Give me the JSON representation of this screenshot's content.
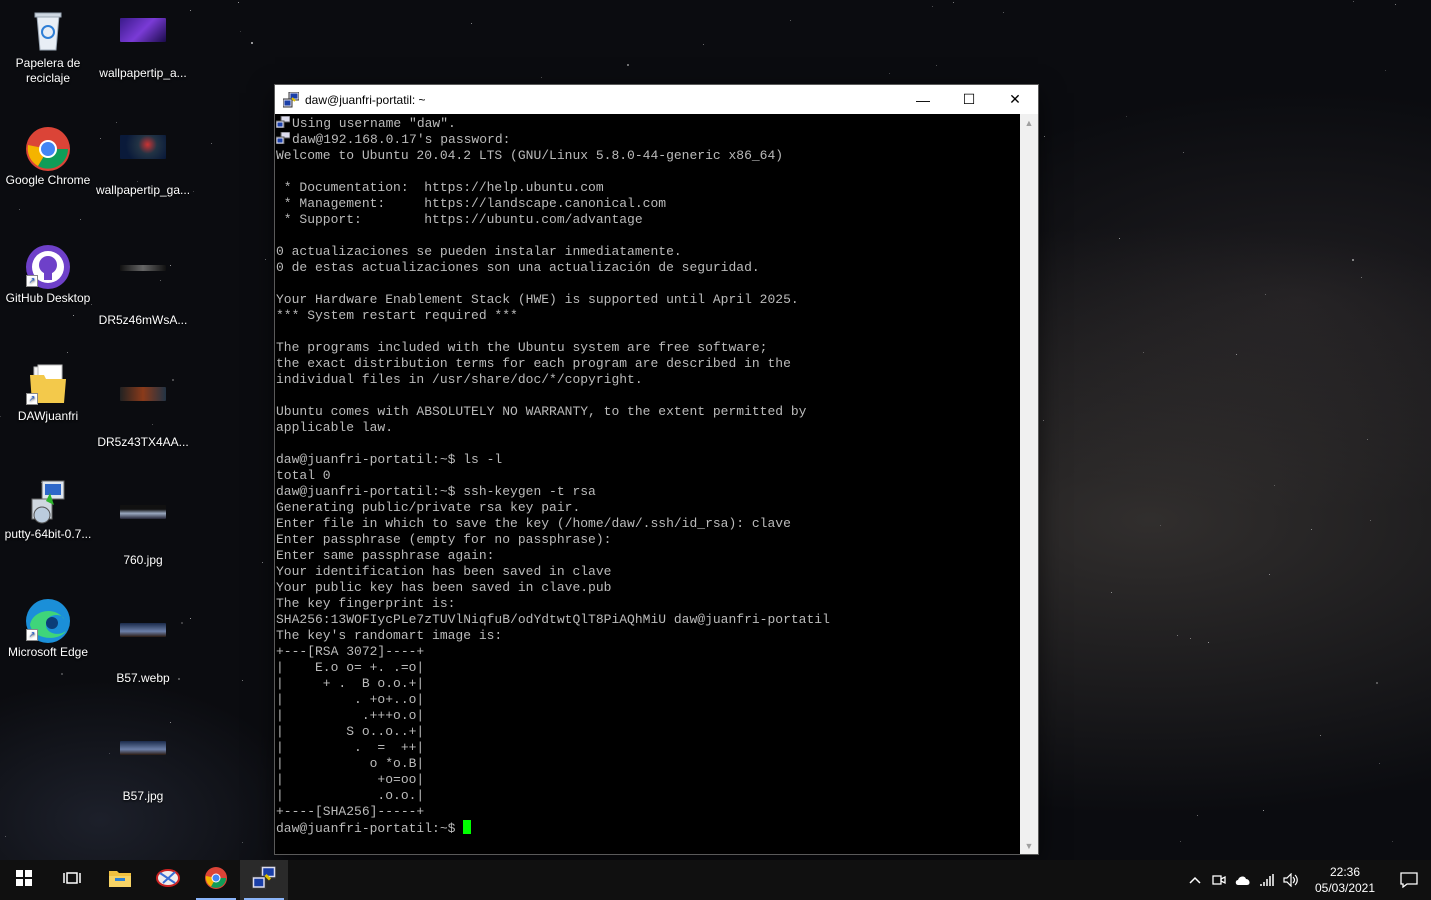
{
  "desktop": {
    "icons": [
      {
        "label": "Papelera de reciclaje",
        "icon": "recycle-bin-icon"
      },
      {
        "label": "wallpapertip_a...",
        "icon": "image-file-icon"
      },
      {
        "label": "Google Chrome",
        "icon": "chrome-icon"
      },
      {
        "label": "wallpapertip_ga...",
        "icon": "image-file-icon"
      },
      {
        "label": "GitHub Desktop",
        "icon": "github-desktop-icon"
      },
      {
        "label": "DR5z46mWsA...",
        "icon": "image-file-icon"
      },
      {
        "label": "DAWjuanfri",
        "icon": "folder-icon"
      },
      {
        "label": "DR5z43TX4AA...",
        "icon": "image-file-icon"
      },
      {
        "label": "putty-64bit-0.7...",
        "icon": "installer-icon"
      },
      {
        "label": "760.jpg",
        "icon": "image-file-icon"
      },
      {
        "label": "Microsoft Edge",
        "icon": "edge-icon"
      },
      {
        "label": "B57.webp",
        "icon": "image-file-icon"
      },
      {
        "label": "B57.jpg",
        "icon": "image-file-icon"
      }
    ]
  },
  "window": {
    "title": "daw@juanfri-portatil: ~",
    "minimize_glyph": "—",
    "maximize_glyph": "☐",
    "close_glyph": "✕"
  },
  "terminal": {
    "lines": [
      "Using username \"daw\".",
      "daw@192.168.0.17's password:",
      "Welcome to Ubuntu 20.04.2 LTS (GNU/Linux 5.8.0-44-generic x86_64)",
      "",
      " * Documentation:  https://help.ubuntu.com",
      " * Management:     https://landscape.canonical.com",
      " * Support:        https://ubuntu.com/advantage",
      "",
      "0 actualizaciones se pueden instalar inmediatamente.",
      "0 de estas actualizaciones son una actualización de seguridad.",
      "",
      "Your Hardware Enablement Stack (HWE) is supported until April 2025.",
      "*** System restart required ***",
      "",
      "The programs included with the Ubuntu system are free software;",
      "the exact distribution terms for each program are described in the",
      "individual files in /usr/share/doc/*/copyright.",
      "",
      "Ubuntu comes with ABSOLUTELY NO WARRANTY, to the extent permitted by",
      "applicable law.",
      "",
      "daw@juanfri-portatil:~$ ls -l",
      "total 0",
      "daw@juanfri-portatil:~$ ssh-keygen -t rsa",
      "Generating public/private rsa key pair.",
      "Enter file in which to save the key (/home/daw/.ssh/id_rsa): clave",
      "Enter passphrase (empty for no passphrase):",
      "Enter same passphrase again:",
      "Your identification has been saved in clave",
      "Your public key has been saved in clave.pub",
      "The key fingerprint is:",
      "SHA256:13WOFIycPLe7zTUVlNiqfuB/odYdtwtQlT8PiAQhMiU daw@juanfri-portatil",
      "The key's randomart image is:",
      "+---[RSA 3072]----+",
      "|    E.o o= +. .=o|",
      "|     + .  B o.o.+|",
      "|         . +o+..o|",
      "|          .+++o.o|",
      "|        S o..o..+|",
      "|         .  =  ++|",
      "|           o *o.B|",
      "|            +o=oo|",
      "|            .o.o.|",
      "+----[SHA256]-----+"
    ],
    "prompt": "daw@juanfri-portatil:~$ "
  },
  "taskbar": {
    "items": [
      {
        "icon": "windows-start-icon"
      },
      {
        "icon": "task-view-icon"
      },
      {
        "icon": "file-explorer-icon"
      },
      {
        "icon": "snipping-tool-icon"
      },
      {
        "icon": "chrome-icon"
      },
      {
        "icon": "putty-icon",
        "active": true
      }
    ],
    "clock_time": "22:36",
    "clock_date": "05/03/2021"
  },
  "colors": {
    "terminal_text": "#bbbbbb",
    "cursor": "#00ff00",
    "taskbar_bg": "#101010"
  }
}
